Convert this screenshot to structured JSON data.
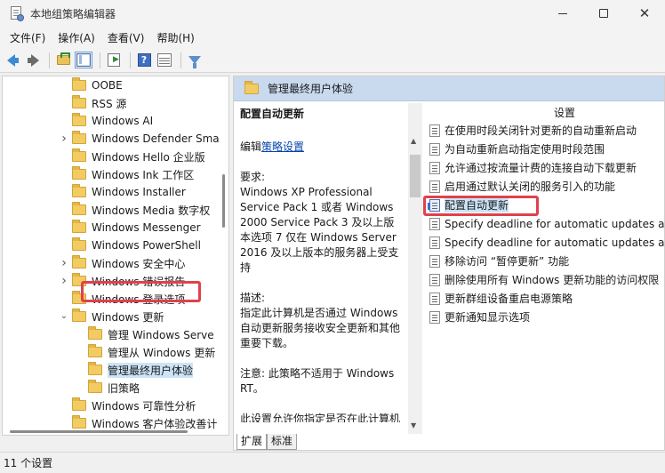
{
  "window": {
    "title": "本地组策略编辑器"
  },
  "menu": {
    "file": "文件(F)",
    "action": "操作(A)",
    "view": "查看(V)",
    "help": "帮助(H)"
  },
  "toolbar": {
    "help_glyph": "?"
  },
  "tree": {
    "items": [
      {
        "label": "OOBE",
        "expandable": false
      },
      {
        "label": "RSS 源",
        "expandable": false
      },
      {
        "label": "Windows AI",
        "expandable": false
      },
      {
        "label": "Windows Defender Sma",
        "expandable": true
      },
      {
        "label": "Windows Hello 企业版",
        "expandable": false
      },
      {
        "label": "Windows Ink 工作区",
        "expandable": false
      },
      {
        "label": "Windows Installer",
        "expandable": false
      },
      {
        "label": "Windows Media 数字权",
        "expandable": false
      },
      {
        "label": "Windows Messenger",
        "expandable": false
      },
      {
        "label": "Windows PowerShell",
        "expandable": false
      },
      {
        "label": "Windows 安全中心",
        "expandable": true
      },
      {
        "label": "Windows 错误报告",
        "expandable": true
      },
      {
        "label": "Windows 登录选项",
        "expandable": false
      },
      {
        "label": "Windows 更新",
        "expandable": true,
        "expanded": true
      },
      {
        "label": "管理 Windows Serve",
        "level": 1
      },
      {
        "label": "管理从 Windows 更新",
        "level": 1
      },
      {
        "label": "管理最终用户体验",
        "level": 1,
        "selected": true
      },
      {
        "label": "旧策略",
        "level": 1
      },
      {
        "label": "Windows 可靠性分析",
        "expandable": false
      },
      {
        "label": "Windows 客户体验改善计",
        "expandable": false
      }
    ]
  },
  "details": {
    "header": "管理最终用户体验",
    "policy_title": "配置自动更新",
    "edit_prefix": "编辑",
    "edit_link": "策略设置",
    "requirements_label": "要求:",
    "requirements_text": "Windows XP Professional Service Pack 1 或者 Windows 2000 Service Pack 3 及以上版本选项 7 仅在 Windows Server 2016 及以上版本的服务器上受支持",
    "description_label": "描述:",
    "description_text": "指定此计算机是否通过 Windows 自动更新服务接收安全更新和其他重要下载。",
    "note_text": "注意: 此策略不适用于 Windows RT。",
    "extra_text": "此设置允许你指定是否在此计算机上启用自动更新。如果启用这项"
  },
  "settings": {
    "column_header": "设置",
    "items": [
      {
        "label": "在使用时段关闭针对更新的自动重新启动"
      },
      {
        "label": "为自动重新启动指定使用时段范围"
      },
      {
        "label": "允许通过按流量计费的连接自动下载更新"
      },
      {
        "label": "启用通过默认关闭的服务引入的功能"
      },
      {
        "label": "配置自动更新",
        "selected": true
      },
      {
        "label": "Specify deadline for automatic updates and"
      },
      {
        "label": "Specify deadline for automatic updates and"
      },
      {
        "label": "移除访问 “暂停更新” 功能"
      },
      {
        "label": "删除使用所有 Windows 更新功能的访问权限"
      },
      {
        "label": "更新群组设备重启电源策略"
      },
      {
        "label": "更新通知显示选项"
      }
    ]
  },
  "tabs": {
    "extended": "扩展",
    "standard": "标准"
  },
  "status": {
    "text": "11 个设置"
  },
  "colors": {
    "accent": "#3f6ec2",
    "highlight": "#e0414a",
    "header_bg": "#c9d9ee",
    "selection": "#cce4f7"
  }
}
